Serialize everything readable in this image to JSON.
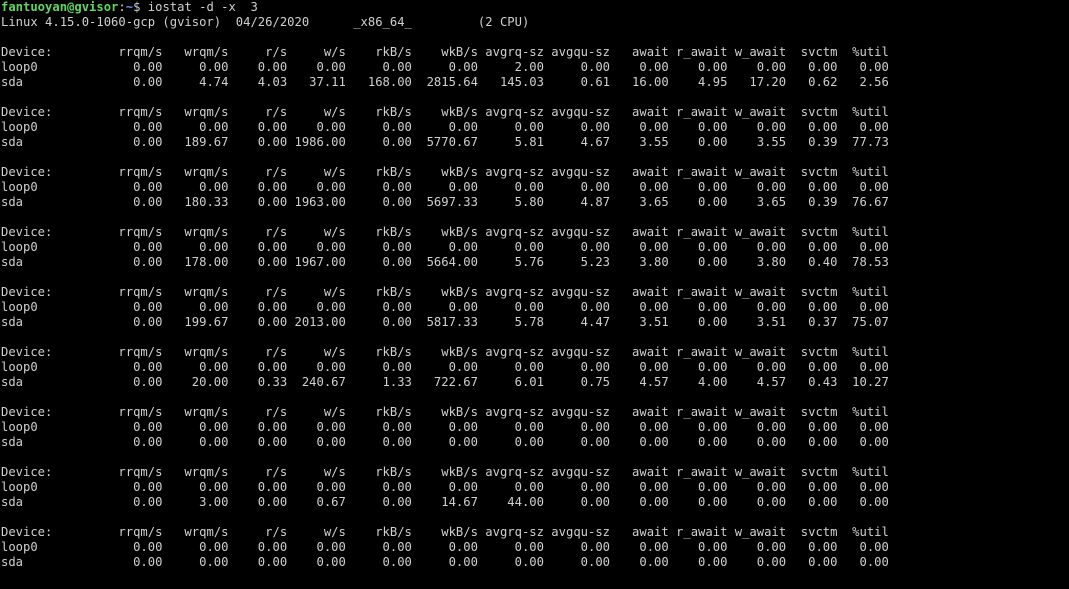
{
  "prompt": {
    "user_host": "fantuoyan@gvisor",
    "separator": ":",
    "path": "~",
    "symbol": "$ ",
    "command": "iostat -d -x  3"
  },
  "system_line": "Linux 4.15.0-1060-gcp (gvisor)  04/26/2020      _x86_64_         (2 CPU)",
  "header_line": "Device:         rrqm/s   wrqm/s     r/s     w/s    rkB/s    wkB/s avgrq-sz avgqu-sz   await r_await w_await  svctm  %util",
  "colors": {
    "background": "#000000",
    "text": "#d0d0d0",
    "prompt_user": "#5fd75f",
    "prompt_path": "#6f8cff"
  },
  "reports": [
    {
      "loop0": "loop0             0.00     0.00    0.00    0.00     0.00     0.00     2.00     0.00    0.00    0.00    0.00   0.00   0.00",
      "sda": "sda               0.00     4.74    4.03   37.11   168.00  2815.64   145.03     0.61   16.00    4.95   17.20   0.62   2.56"
    },
    {
      "loop0": "loop0             0.00     0.00    0.00    0.00     0.00     0.00     0.00     0.00    0.00    0.00    0.00   0.00   0.00",
      "sda": "sda               0.00   189.67    0.00 1986.00     0.00  5770.67     5.81     4.67    3.55    0.00    3.55   0.39  77.73"
    },
    {
      "loop0": "loop0             0.00     0.00    0.00    0.00     0.00     0.00     0.00     0.00    0.00    0.00    0.00   0.00   0.00",
      "sda": "sda               0.00   180.33    0.00 1963.00     0.00  5697.33     5.80     4.87    3.65    0.00    3.65   0.39  76.67"
    },
    {
      "loop0": "loop0             0.00     0.00    0.00    0.00     0.00     0.00     0.00     0.00    0.00    0.00    0.00   0.00   0.00",
      "sda": "sda               0.00   178.00    0.00 1967.00     0.00  5664.00     5.76     5.23    3.80    0.00    3.80   0.40  78.53"
    },
    {
      "loop0": "loop0             0.00     0.00    0.00    0.00     0.00     0.00     0.00     0.00    0.00    0.00    0.00   0.00   0.00",
      "sda": "sda               0.00   199.67    0.00 2013.00     0.00  5817.33     5.78     4.47    3.51    0.00    3.51   0.37  75.07"
    },
    {
      "loop0": "loop0             0.00     0.00    0.00    0.00     0.00     0.00     0.00     0.00    0.00    0.00    0.00   0.00   0.00",
      "sda": "sda               0.00    20.00    0.33  240.67     1.33   722.67     6.01     0.75    4.57    4.00    4.57   0.43  10.27"
    },
    {
      "loop0": "loop0             0.00     0.00    0.00    0.00     0.00     0.00     0.00     0.00    0.00    0.00    0.00   0.00   0.00",
      "sda": "sda               0.00     0.00    0.00    0.00     0.00     0.00     0.00     0.00    0.00    0.00    0.00   0.00   0.00"
    },
    {
      "loop0": "loop0             0.00     0.00    0.00    0.00     0.00     0.00     0.00     0.00    0.00    0.00    0.00   0.00   0.00",
      "sda": "sda               0.00     3.00    0.00    0.67     0.00    14.67    44.00     0.00    0.00    0.00    0.00   0.00   0.00"
    },
    {
      "loop0": "loop0             0.00     0.00    0.00    0.00     0.00     0.00     0.00     0.00    0.00    0.00    0.00   0.00   0.00",
      "sda": "sda               0.00     0.00    0.00    0.00     0.00     0.00     0.00     0.00    0.00    0.00    0.00   0.00   0.00"
    }
  ]
}
